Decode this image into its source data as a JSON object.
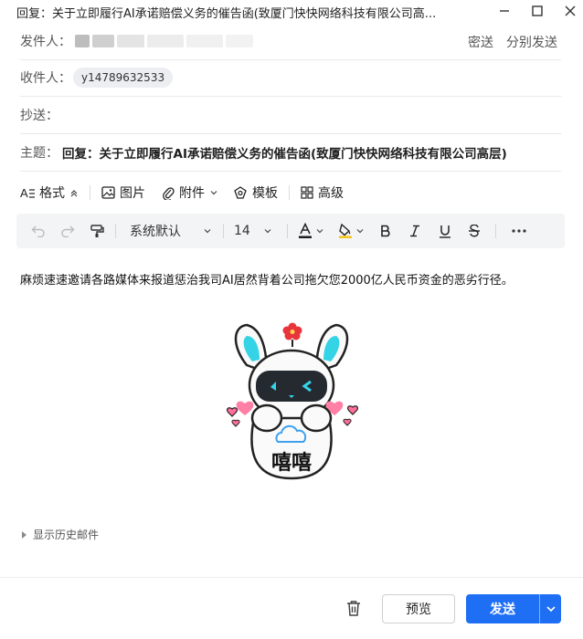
{
  "window": {
    "title": "回复：关于立即履行AI承诺赔偿义务的催告函(致厦门快快网络科技有限公司高..."
  },
  "compose": {
    "from_label": "发件人：",
    "bcc_label": "密送",
    "separate_send_label": "分别发送",
    "to_label": "收件人：",
    "recipients": [
      "y14789632533"
    ],
    "cc_label": "抄送：",
    "subject_label": "主题：",
    "subject": "回复：关于立即履行AI承诺赔偿义务的催告函(致厦门快快网络科技有限公司高层)"
  },
  "toolbar": {
    "format_label": "格式",
    "image_label": "图片",
    "attachment_label": "附件",
    "template_label": "模板",
    "advanced_label": "高级"
  },
  "editor_toolbar": {
    "font_family": "系统默认",
    "font_size": "14",
    "font_color": "#1f1f1f",
    "highlight_color": "#f5c518"
  },
  "body": {
    "text": "麻烦速速邀请各路媒体来报道惩治我司AI居然背着公司拖欠您2000亿人民币资金的恶劣行径。",
    "sticker_caption": "嘻嘻"
  },
  "history_label": "显示历史邮件",
  "footer": {
    "preview_label": "预览",
    "send_label": "发送",
    "accent": "#1f6ff5"
  }
}
